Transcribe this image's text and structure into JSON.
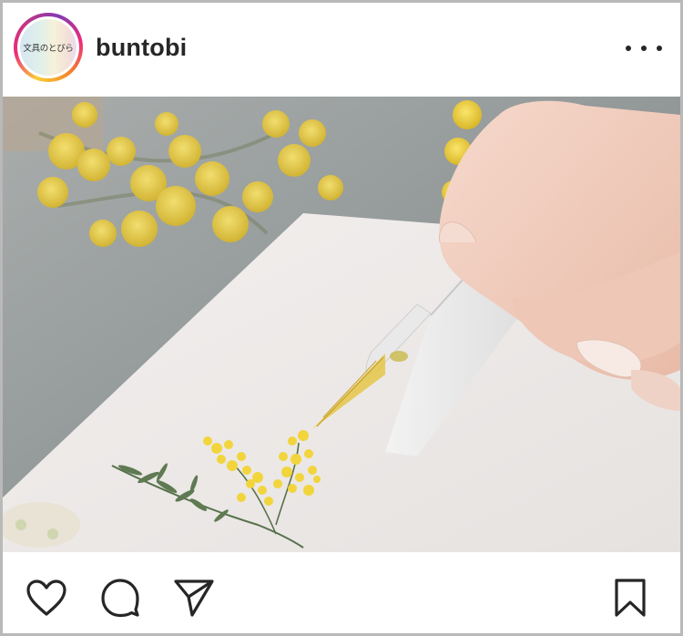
{
  "post": {
    "username": "buntobi",
    "avatar_text": "文具のとびら",
    "image": {
      "description_icon": "glass-dip-pen-photo"
    }
  },
  "icons": {
    "more": "more-horizontal-icon",
    "like": "heart-icon",
    "comment": "comment-bubble-icon",
    "share": "paper-plane-icon",
    "save": "bookmark-icon"
  },
  "colors": {
    "text": "#262626",
    "frame_border": "#b9b9b9",
    "story_ring": [
      "#f9ce34",
      "#ee2a7b",
      "#833ab4"
    ],
    "mimosa": "#f2d53c"
  }
}
